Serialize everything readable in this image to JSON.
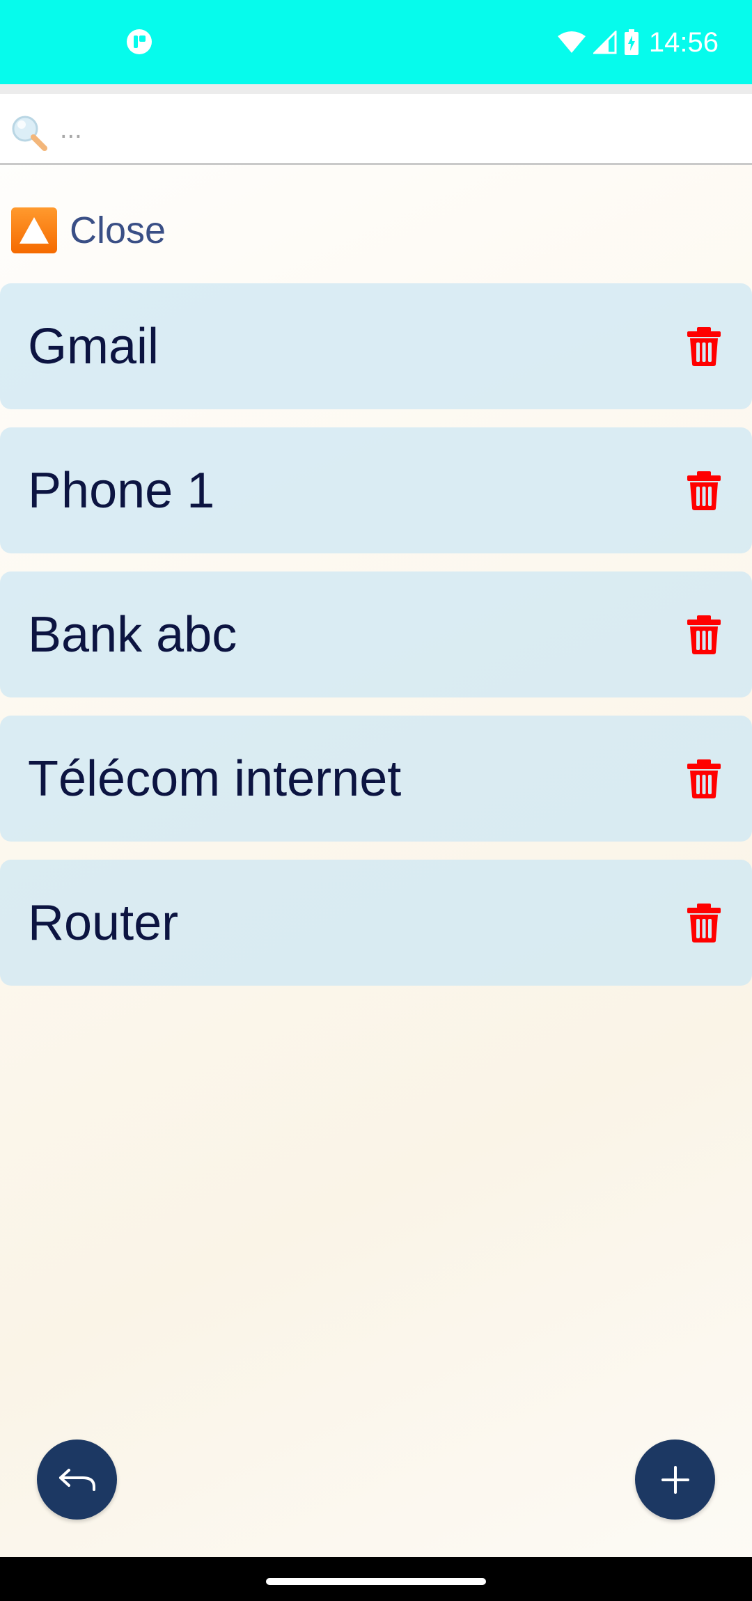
{
  "status_bar": {
    "time": "14:56",
    "background_color": "#06fbec",
    "icons": [
      "app-notification-icon",
      "wifi-icon",
      "cell-signal-icon",
      "battery-charging-icon"
    ]
  },
  "search": {
    "placeholder": "...",
    "value": "",
    "icon": "magnifier-icon"
  },
  "group_toggle": {
    "label": "Close",
    "icon": "up-triangle-icon"
  },
  "items": [
    {
      "name": "Gmail"
    },
    {
      "name": "Phone 1"
    },
    {
      "name": "Bank abc"
    },
    {
      "name": "Télécom internet"
    },
    {
      "name": "Router"
    }
  ],
  "item_action_icon": "trash-icon",
  "colors": {
    "item_background": "#d3ebf5",
    "item_text": "#0c1441",
    "delete_icon": "#ff0000",
    "fab_background": "#1c3863",
    "toggle_text": "#3a4f86"
  },
  "fab": {
    "back_icon": "undo-arrow-icon",
    "add_icon": "plus-icon"
  }
}
